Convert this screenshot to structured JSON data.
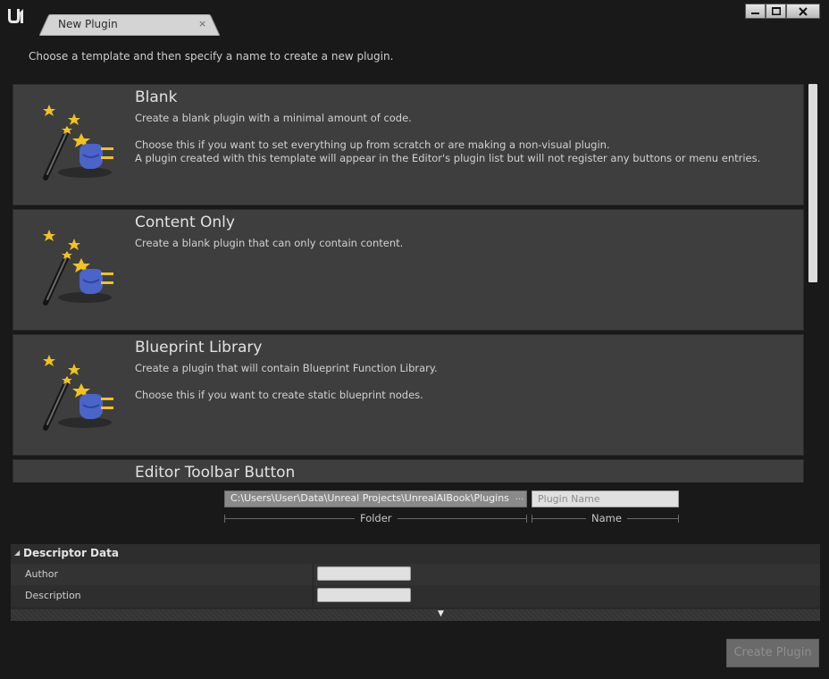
{
  "window": {
    "tab_title": "New Plugin",
    "tab_close": "×",
    "controls": {
      "minimize": "minimize-icon",
      "maximize": "maximize-icon",
      "close": "close-icon"
    }
  },
  "instructions": "Choose a template and then specify a name to create a new plugin.",
  "templates": [
    {
      "title": "Blank",
      "description": "Create a blank plugin with a minimal amount of code.\n\nChoose this if you want to set everything up from scratch or are making a non-visual plugin.\nA plugin created with this template will appear in the Editor's plugin list but will not register any buttons or menu entries."
    },
    {
      "title": "Content Only",
      "description": "Create a blank plugin that can only contain content."
    },
    {
      "title": "Blueprint Library",
      "description": "Create a plugin that will contain Blueprint Function Library.\n\nChoose this if you want to create static blueprint nodes."
    },
    {
      "title": "Editor Toolbar Button",
      "description": ""
    }
  ],
  "folder": {
    "value": "C:\\Users\\User\\Data\\Unreal Projects\\UnrealAIBook\\Plugins",
    "browse": "...",
    "label": "Folder"
  },
  "name": {
    "placeholder": "Plugin Name",
    "label": "Name"
  },
  "descriptor": {
    "header": "Descriptor Data",
    "rows": [
      {
        "label": "Author",
        "value": ""
      },
      {
        "label": "Description",
        "value": ""
      }
    ]
  },
  "create_button": "Create Plugin",
  "colors": {
    "background": "#191919",
    "card": "#3e3e3e",
    "accent_star": "#f2c31b",
    "plug_blue": "#4a64c8"
  }
}
